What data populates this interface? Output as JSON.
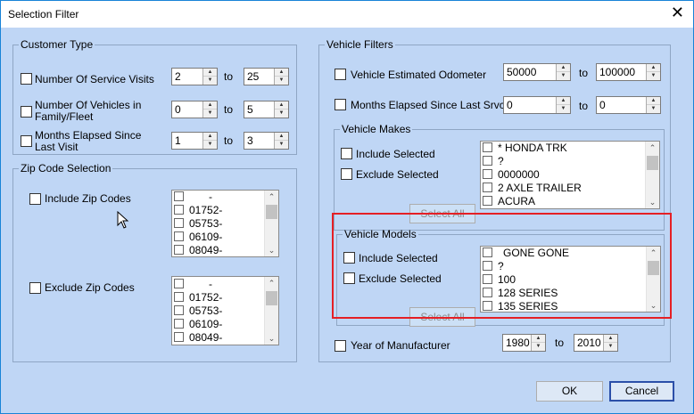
{
  "window": {
    "title": "Selection Filter",
    "close_glyph": "✕"
  },
  "customer_type": {
    "legend": "Customer Type",
    "rows": [
      {
        "label": "Number Of Service Visits",
        "from": "2",
        "to": "25"
      },
      {
        "label": "Number Of Vehicles in Family/Fleet",
        "from": "0",
        "to": "5"
      },
      {
        "label": "Months Elapsed Since Last Visit",
        "from": "1",
        "to": "3"
      }
    ],
    "to_label": "to"
  },
  "zip_code": {
    "legend": "Zip Code Selection",
    "include_label": "Include Zip Codes",
    "exclude_label": "Exclude Zip Codes",
    "include_items": [
      "-",
      "01752-",
      "05753-",
      "06109-",
      "08049-"
    ],
    "exclude_items": [
      "-",
      "01752-",
      "05753-",
      "06109-",
      "08049-"
    ]
  },
  "vehicle_filters": {
    "legend": "Vehicle Filters",
    "odometer": {
      "label": "Vehicle Estimated Odometer",
      "from": "50000",
      "to": "100000"
    },
    "months": {
      "label": "Months Elapsed Since Last Srvc",
      "from": "0",
      "to": "0"
    },
    "to_label": "to",
    "makes": {
      "legend": "Vehicle Makes",
      "include_label": "Include Selected",
      "exclude_label": "Exclude Selected",
      "select_all": "Select All",
      "items": [
        "* HONDA TRK",
        "?",
        "0000000",
        "2 AXLE TRAILER",
        "ACURA"
      ]
    },
    "models": {
      "legend": "Vehicle Models",
      "include_label": "Include Selected",
      "exclude_label": "Exclude Selected",
      "select_all": "Select All",
      "items": [
        "GONE GONE",
        "?",
        "100",
        "128 SERIES",
        "135 SERIES"
      ]
    },
    "year": {
      "label": "Year of Manufacturer",
      "from": "1980",
      "to": "2010"
    }
  },
  "buttons": {
    "ok": "OK",
    "cancel": "Cancel"
  },
  "colors": {
    "highlight": "#e51f25",
    "background": "#bfd6f5"
  },
  "icons": {
    "spinner_up": "▲",
    "spinner_down": "▼",
    "scroll_up": "⌃",
    "scroll_down": "⌄",
    "cursor": "arrow-cursor-icon"
  }
}
